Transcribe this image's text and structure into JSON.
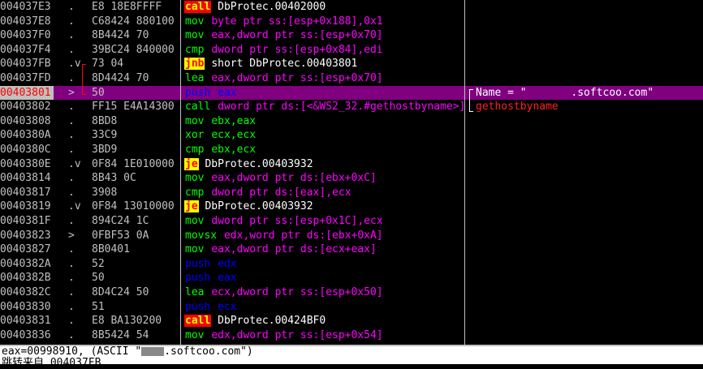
{
  "rows": [
    {
      "addr": "004037E3",
      "mark": ".",
      "hex": "E8 18E8FFFF",
      "mn": "call",
      "mn_type": "call",
      "target": "DbProtec.00402000",
      "ops": "",
      "cmt": ""
    },
    {
      "addr": "004037E8",
      "mark": ".",
      "hex": "C68424 880100",
      "mn": "mov",
      "mn_type": "other",
      "target": "",
      "ops": "byte ptr ss:[esp+0x188],0x1",
      "cmt": ""
    },
    {
      "addr": "004037F0",
      "mark": ".",
      "hex": "8B4424 70",
      "mn": "mov",
      "mn_type": "other",
      "target": "",
      "ops": "eax,dword ptr ss:[esp+0x70]",
      "cmt": ""
    },
    {
      "addr": "004037F4",
      "mark": ".",
      "hex": "39BC24 840000",
      "mn": "cmp",
      "mn_type": "other",
      "target": "",
      "ops": "dword ptr ss:[esp+0x84],edi",
      "cmt": ""
    },
    {
      "addr": "004037FB",
      "mark": ".v",
      "hex": "73 04",
      "mn": "jnb",
      "mn_type": "jcc",
      "target": "short DbProtec.00403801",
      "ops": "",
      "cmt": ""
    },
    {
      "addr": "004037FD",
      "mark": ".",
      "hex": "8D4424 70",
      "mn": "lea",
      "mn_type": "other",
      "target": "",
      "ops": "eax,dword ptr ss:[esp+0x70]",
      "cmt": ""
    },
    {
      "addr": "00403801",
      "mark": ">",
      "hex": "50",
      "mn": "push",
      "mn_type": "push",
      "target": "",
      "ops": "eax",
      "cmt": "Name = \"       .softcoo.com\"",
      "selected": true
    },
    {
      "addr": "00403802",
      "mark": ".",
      "hex": "FF15 E4A14300",
      "mn": "call",
      "mn_type": "other",
      "target": "",
      "ops": "dword ptr ds:[<&WS2_32.#gethostbyname>]",
      "cmt": "gethostbyname",
      "cmt_red": true
    },
    {
      "addr": "00403808",
      "mark": ".",
      "hex": "8BD8",
      "mn": "mov",
      "mn_type": "other",
      "target": "",
      "ops": "ebx,eax",
      "cmt": ""
    },
    {
      "addr": "0040380A",
      "mark": ".",
      "hex": "33C9",
      "mn": "xor",
      "mn_type": "other",
      "target": "",
      "ops": "ecx,ecx",
      "cmt": ""
    },
    {
      "addr": "0040380C",
      "mark": ".",
      "hex": "3BD9",
      "mn": "cmp",
      "mn_type": "other",
      "target": "",
      "ops": "ebx,ecx",
      "cmt": ""
    },
    {
      "addr": "0040380E",
      "mark": ".v",
      "hex": "0F84 1E010000",
      "mn": "je",
      "mn_type": "jcc",
      "target": "DbProtec.00403932",
      "ops": "",
      "cmt": ""
    },
    {
      "addr": "00403814",
      "mark": ".",
      "hex": "8B43 0C",
      "mn": "mov",
      "mn_type": "other",
      "target": "",
      "ops": "eax,dword ptr ds:[ebx+0xC]",
      "cmt": ""
    },
    {
      "addr": "00403817",
      "mark": ".",
      "hex": "3908",
      "mn": "cmp",
      "mn_type": "other",
      "target": "",
      "ops": "dword ptr ds:[eax],ecx",
      "cmt": ""
    },
    {
      "addr": "00403819",
      "mark": ".v",
      "hex": "0F84 13010000",
      "mn": "je",
      "mn_type": "jcc",
      "target": "DbProtec.00403932",
      "ops": "",
      "cmt": ""
    },
    {
      "addr": "0040381F",
      "mark": ".",
      "hex": "894C24 1C",
      "mn": "mov",
      "mn_type": "other",
      "target": "",
      "ops": "dword ptr ss:[esp+0x1C],ecx",
      "cmt": ""
    },
    {
      "addr": "00403823",
      "mark": ">",
      "hex": "0FBF53 0A",
      "mn": "movsx",
      "mn_type": "other",
      "target": "",
      "ops": "edx,word ptr ds:[ebx+0xA]",
      "cmt": ""
    },
    {
      "addr": "00403827",
      "mark": ".",
      "hex": "8B0401",
      "mn": "mov",
      "mn_type": "other",
      "target": "",
      "ops": "eax,dword ptr ds:[ecx+eax]",
      "cmt": ""
    },
    {
      "addr": "0040382A",
      "mark": ".",
      "hex": "52",
      "mn": "push",
      "mn_type": "push",
      "target": "",
      "ops": "edx",
      "cmt": ""
    },
    {
      "addr": "0040382B",
      "mark": ".",
      "hex": "50",
      "mn": "push",
      "mn_type": "push",
      "target": "",
      "ops": "eax",
      "cmt": ""
    },
    {
      "addr": "0040382C",
      "mark": ".",
      "hex": "8D4C24 50",
      "mn": "lea",
      "mn_type": "other",
      "target": "",
      "ops": "ecx,dword ptr ss:[esp+0x50]",
      "cmt": ""
    },
    {
      "addr": "00403830",
      "mark": ".",
      "hex": "51",
      "mn": "push",
      "mn_type": "push",
      "target": "",
      "ops": "ecx",
      "cmt": ""
    },
    {
      "addr": "00403831",
      "mark": ".",
      "hex": "E8 BA130200",
      "mn": "call",
      "mn_type": "call",
      "target": "DbProtec.00424BF0",
      "ops": "",
      "cmt": ""
    },
    {
      "addr": "00403836",
      "mark": ".",
      "hex": "8B5424 54",
      "mn": "mov",
      "mn_type": "other",
      "target": "",
      "ops": "edx,dword ptr ss:[esp+0x54]",
      "cmt": ""
    }
  ],
  "info": {
    "line1_prefix": "eax=00998910, (ASCII \"",
    "line1_suffix": ".softcoo.com\")",
    "line2": "跳转来自 004037FB"
  },
  "colors": {
    "background": "#000000",
    "selected_row": "#800080",
    "call_bg": "#ff0000",
    "jcc_bg": "#ffff00",
    "push": "#0000ff",
    "operand_green": "#00ff00",
    "memory_magenta": "#ff00ff"
  }
}
